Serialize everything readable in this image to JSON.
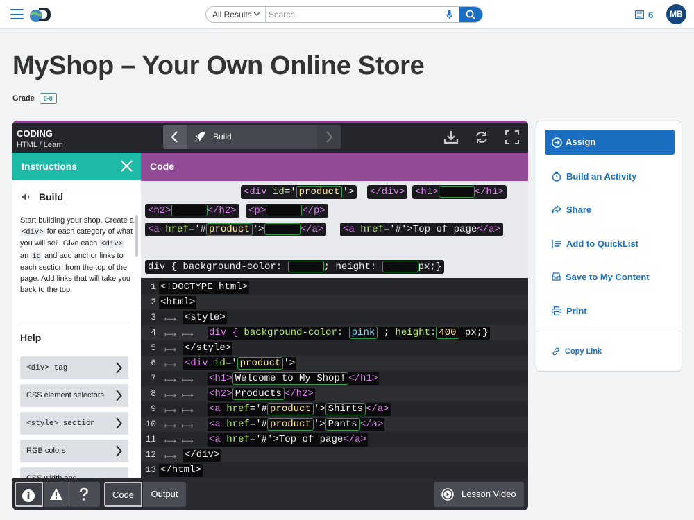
{
  "topbar": {
    "all_results": "All Results",
    "search_placeholder": "Search",
    "quicklist_count": "6",
    "avatar_initials": "MB"
  },
  "page": {
    "title": "MyShop – Your Own Online Store",
    "grade_label": "Grade",
    "grade_value": "6-8"
  },
  "lab": {
    "category": "CODING",
    "breadcrumb_1": "HTML",
    "breadcrumb_sep": "/",
    "breadcrumb_2": "Learn",
    "step_label": "Build",
    "instructions": {
      "header": "Instructions",
      "step_title": "Build",
      "text_1": "Start building your shop. Create a ",
      "code_1": "<div>",
      "text_2": " for each category of what you will sell. Give each ",
      "code_2": "<div>",
      "text_3": " an ",
      "code_3": "id",
      "text_4": " and add anchor links to each section from the top of the page. Add links that will take you back to the top.",
      "help_title": "Help",
      "help_items": [
        "<div> tag",
        "CSS element selectors",
        "<style> section",
        "RGB colors",
        "CSS width and"
      ]
    },
    "code_header": "Code",
    "tray": {
      "t1": {
        "open": "<div ",
        "attr": "id",
        "eq": "='",
        "str": "product",
        "close": "'>"
      },
      "t2": "</div>",
      "t3": {
        "open": "<h1>",
        "close": "</h1>"
      },
      "t4": {
        "open": "<h2>",
        "close": "</h2>"
      },
      "t5": {
        "open": "<p>",
        "close": "</p>"
      },
      "t6": {
        "open": "<a ",
        "attr": "href",
        "eq": "='#",
        "str": "product",
        "mid": "'>",
        "close": "</a>"
      },
      "t7": {
        "open": "<a ",
        "attr": "href",
        "eq": "='#'>",
        "text": "Top of page",
        "close": "</a>"
      },
      "t8": {
        "a": "div { background-color: ",
        "b": "; height: ",
        "c": "px;}"
      }
    },
    "editor": {
      "l1": "<!DOCTYPE html>",
      "l2": "<html>",
      "l3": "<style>",
      "l4": {
        "a": "div { ",
        "attr": "background-color:",
        "val": "pink",
        "b": " ; ",
        "attr2": "height:",
        "val2": "400",
        "c": " px;}"
      },
      "l5": "</style>",
      "l6": {
        "open": "<div ",
        "attr": "id",
        "eq": "='",
        "val": "product",
        "close": "'>"
      },
      "l7": {
        "open": "<h1>",
        "val": "Welcome to My Shop!",
        "close": "</h1>"
      },
      "l8": {
        "open": "<h2>",
        "val": "Products",
        "close": "</h2>"
      },
      "l9": {
        "open": "<a ",
        "attr": "href",
        "eq": "='#",
        "val": "product",
        "mid": "'>",
        "val2": "Shirts",
        "close": "</a>"
      },
      "l10": {
        "open": "<a ",
        "attr": "href",
        "eq": "='#",
        "val": "product",
        "mid": "'>",
        "val2": "Pants",
        "close": "</a>"
      },
      "l11": {
        "open": "<a ",
        "attr": "href",
        "eq": "='#'>",
        "text": "Top of page",
        "close": "</a>"
      },
      "l12": "</div>",
      "l13": "</html>",
      "line_numbers": [
        "1",
        "2",
        "3",
        "4",
        "5",
        "6",
        "7",
        "8",
        "9",
        "10",
        "11",
        "12",
        "13"
      ]
    },
    "footer": {
      "tab_code": "Code",
      "tab_output": "Output",
      "lesson_video": "Lesson Video"
    }
  },
  "sidebar": {
    "assign": "Assign",
    "build_activity": "Build an Activity",
    "share": "Share",
    "add_quicklist": "Add to QuickList",
    "save_content": "Save to My Content",
    "print": "Print",
    "copy_link": "Copy Link"
  },
  "colors": {
    "brand_blue": "#1a6fc2",
    "instructions_teal": "#1ebaa8",
    "code_purple": "#924c97",
    "blank_green": "#23a24a"
  }
}
